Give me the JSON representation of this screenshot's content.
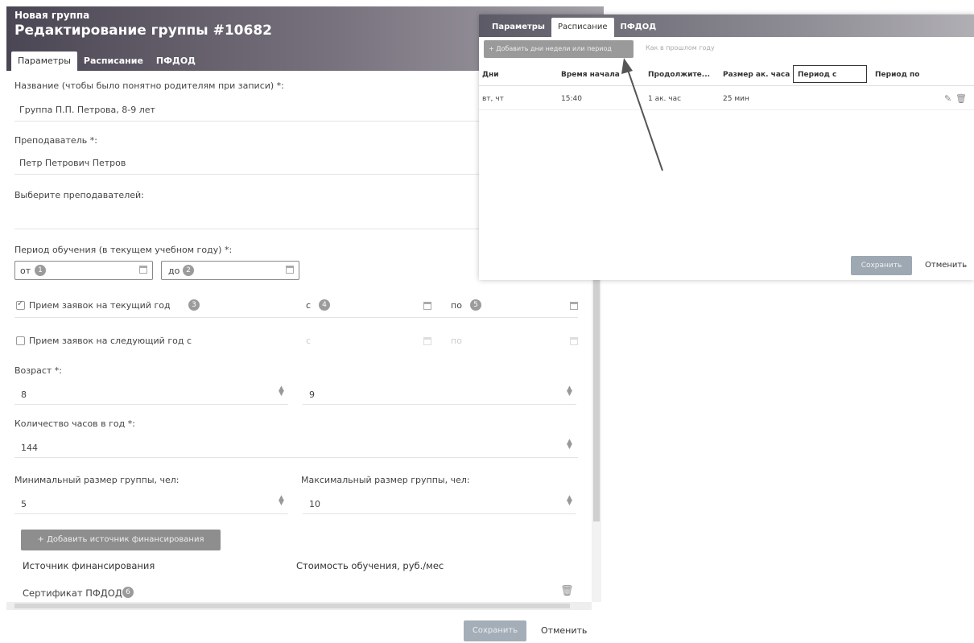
{
  "left": {
    "subtitle": "Новая группа",
    "title": "Редактирование группы #10682",
    "tabs": [
      "Параметры",
      "Расписание",
      "ПФДОД"
    ],
    "name_label": "Название (чтобы было понятно родителям при записи) *:",
    "name_value": "Группа П.П. Петрова, 8-9 лет",
    "teacher_label": "Преподаватель *:",
    "teacher_value": "Петр Петрович Петров",
    "teachers_label": "Выберите преподавателей:",
    "period_label": "Период обучения (в текущем учебном году) *:",
    "period_from": "от",
    "period_to": "до",
    "badges": [
      "1",
      "2",
      "3",
      "4",
      "5",
      "6"
    ],
    "cur_year_label": "Прием заявок на текущий год",
    "cur_from": "с",
    "cur_to": "по",
    "next_year_label": "Прием заявок на следующий год с",
    "next_from": "с",
    "next_to": "по",
    "age_label": "Возраст *:",
    "age_from": "8",
    "age_to": "9",
    "hours_label": "Количество часов в год *:",
    "hours_value": "144",
    "min_label": "Минимальный размер группы, чел:",
    "min_value": "5",
    "max_label": "Максимальный размер группы, чел:",
    "max_value": "10",
    "add_source": "+ Добавить источник финансирования",
    "col_source": "Источник финансирования",
    "col_cost": "Стоимость обучения, руб./мес",
    "source_value": "Сертификат ПФДОД",
    "save": "Сохранить",
    "cancel": "Отменить"
  },
  "right": {
    "tabs": [
      "Параметры",
      "Расписание",
      "ПФДОД"
    ],
    "add_btn": "+ Добавить дни недели или период",
    "hint": "Как в прошлом году",
    "headers": [
      "Дни",
      "Время начала",
      "Продолжите...",
      "Размер ак. часа",
      "Период с",
      "Период по"
    ],
    "row": [
      "вт, чт",
      "15:40",
      "1 ак. час",
      "25 мин"
    ],
    "save": "Сохранить",
    "cancel": "Отменить"
  },
  "colors": {
    "header_dark": "#4b4653",
    "button_grey": "#8e8e8e",
    "badge_grey": "#9b9b9b"
  }
}
